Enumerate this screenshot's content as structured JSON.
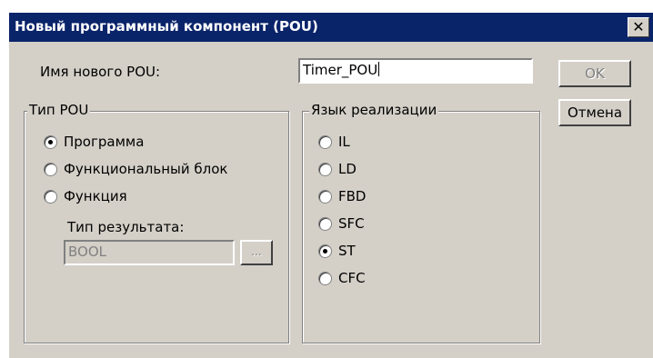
{
  "dialog": {
    "title": "Новый программный компонент (POU)",
    "close_glyph": "✕"
  },
  "name_field": {
    "label": "Имя нового POU:",
    "value": "Timer_POU"
  },
  "buttons": {
    "ok": "OK",
    "cancel": "Отмена",
    "browse": "..."
  },
  "pou_type": {
    "legend": "Тип POU",
    "options": [
      {
        "label": "Программа",
        "checked": true
      },
      {
        "label": "Функциональный блок",
        "checked": false
      },
      {
        "label": "Функция",
        "checked": false
      }
    ],
    "result_label": "Тип результата:",
    "result_value": "BOOL"
  },
  "language": {
    "legend": "Язык реализации",
    "options": [
      {
        "label": "IL",
        "checked": false
      },
      {
        "label": "LD",
        "checked": false
      },
      {
        "label": "FBD",
        "checked": false
      },
      {
        "label": "SFC",
        "checked": false
      },
      {
        "label": "ST",
        "checked": true
      },
      {
        "label": "CFC",
        "checked": false
      }
    ]
  }
}
